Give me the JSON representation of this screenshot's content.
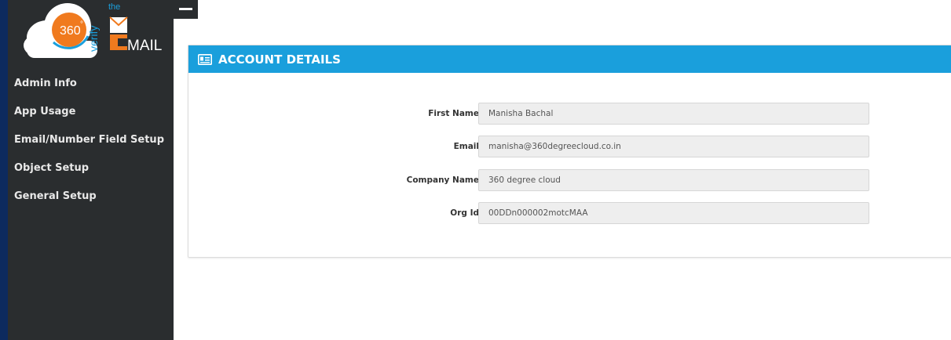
{
  "sidebar": {
    "logo": {
      "num": "360",
      "degree": "°",
      "verify": "verify",
      "the": "the",
      "mail": "MAIL"
    },
    "items": [
      {
        "label": "Admin Info"
      },
      {
        "label": "App Usage"
      },
      {
        "label": "Email/Number Field Setup"
      },
      {
        "label": "Object Setup"
      },
      {
        "label": "General Setup"
      }
    ]
  },
  "panel": {
    "title": "ACCOUNT DETAILS",
    "header_color": "#1a9fdc",
    "icon": "id-card-icon",
    "fields": [
      {
        "label": "First Name",
        "value": "Manisha Bachal"
      },
      {
        "label": "Email",
        "value": "manisha@360degreecloud.co.in"
      },
      {
        "label": "Company Name",
        "value": "360 degree cloud"
      },
      {
        "label": "Org Id",
        "value": "00DDn000002motcMAA"
      }
    ]
  }
}
